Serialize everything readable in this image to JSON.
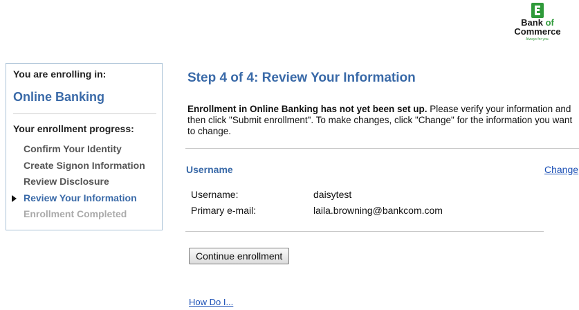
{
  "brand": {
    "name_part1": "Bank",
    "name_part2": "of",
    "name_part3": "Commerce",
    "tagline": "Always for you.",
    "accent_color": "#2f9a3a",
    "icon": "bank-logo-icon"
  },
  "sidebar": {
    "enrolling_label": "You are enrolling in:",
    "product": "Online Banking",
    "progress_label": "Your enrollment progress:",
    "steps": [
      {
        "label": "Confirm Your Identity",
        "state": "done"
      },
      {
        "label": "Create Signon Information",
        "state": "done"
      },
      {
        "label": "Review Disclosure",
        "state": "done"
      },
      {
        "label": "Review Your Information",
        "state": "current"
      },
      {
        "label": "Enrollment Completed",
        "state": "pending"
      }
    ],
    "current_indicator_icon": "triangle-right-icon"
  },
  "main": {
    "title": "Step 4 of 4: Review Your Information",
    "intro_bold": "Enrollment in Online Banking has not yet been set up.",
    "intro_rest": " Please verify your information and then click \"Submit enrollment\". To make changes, click \"Change\" for the information you want to change.",
    "section_title": "Username",
    "change_link": "Change",
    "fields": [
      {
        "label": "Username:",
        "value": "daisytest"
      },
      {
        "label": "Primary e-mail:",
        "value": "laila.browning@bankcom.com"
      }
    ],
    "continue_button": "Continue enrollment",
    "help_link": "How Do I..."
  },
  "colors": {
    "heading_blue": "#3a6aa8",
    "link_blue": "#1a4fb5",
    "sidebar_border": "#a9c1d6"
  }
}
